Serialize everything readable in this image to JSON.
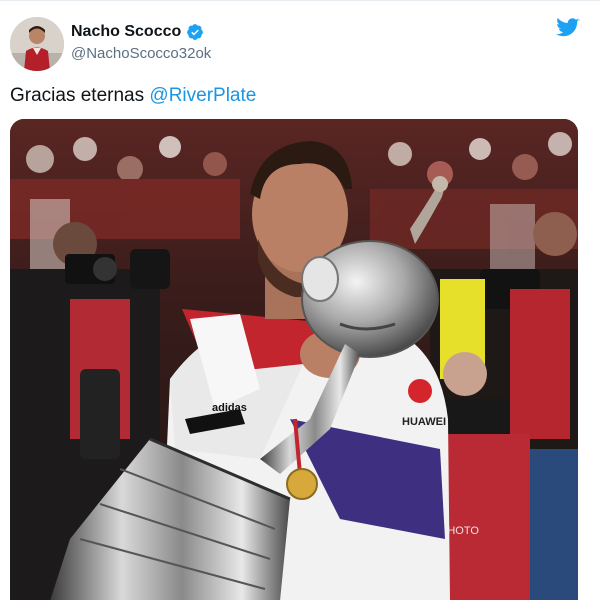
{
  "author": {
    "display_name": "Nacho Scocco",
    "handle": "@NachoScocco32ok",
    "verified_icon": "verified-badge-icon",
    "avatar_icon": "profile-avatar"
  },
  "platform": {
    "logo_icon": "twitter-bird-icon",
    "logo_color": "#1da1f2"
  },
  "tweet": {
    "text_prefix": "Gracias eternas ",
    "mention": "@RiverPlate",
    "mention_color": "#1b95e0"
  },
  "media": {
    "kit_brand": "adidas",
    "sponsor": "HUAWEI",
    "bib_text": "PHOTO"
  },
  "colors": {
    "verified": "#1da1f2",
    "handle": "#5b7083",
    "text": "#0f1419"
  }
}
